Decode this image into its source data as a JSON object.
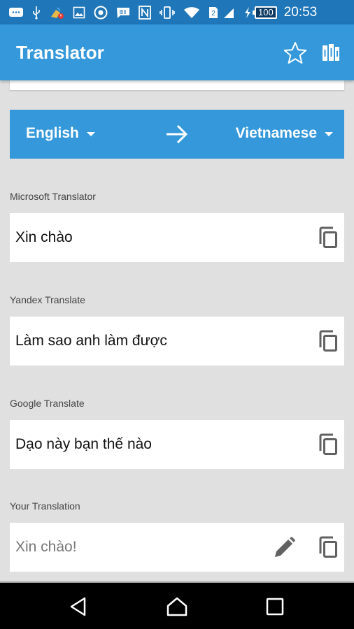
{
  "status_bar": {
    "icons": [
      "chat-bubble-icon",
      "usb-icon",
      "cleaner-alert-icon",
      "gallery-icon",
      "chrome-icon",
      "message-icon",
      "nfc-icon",
      "vibrate-icon",
      "wifi-icon",
      "sim-2-icon",
      "signal-icon",
      "charging-icon"
    ],
    "sim_slot": "2",
    "battery_level": "100",
    "time": "20:53"
  },
  "app_bar": {
    "title": "Translator",
    "favorite_icon": "star-outline-icon",
    "library_icon": "books-icon"
  },
  "language_bar": {
    "source_language": "English",
    "target_language": "Vietnamese",
    "swap_icon": "arrow-right-icon"
  },
  "results": [
    {
      "provider": "Microsoft Translator",
      "text": "Xin chào"
    },
    {
      "provider": "Yandex Translate",
      "text": "Làm sao anh làm được"
    },
    {
      "provider": "Google Translate",
      "text": "Dạo này bạn thế nào"
    }
  ],
  "your_translation": {
    "label": "Your Translation",
    "text": "Xin chào!"
  },
  "colors": {
    "primary": "#3498db",
    "status_bar": "#1f76b8",
    "background": "#e0e0e0",
    "icon_gray": "#616161"
  }
}
